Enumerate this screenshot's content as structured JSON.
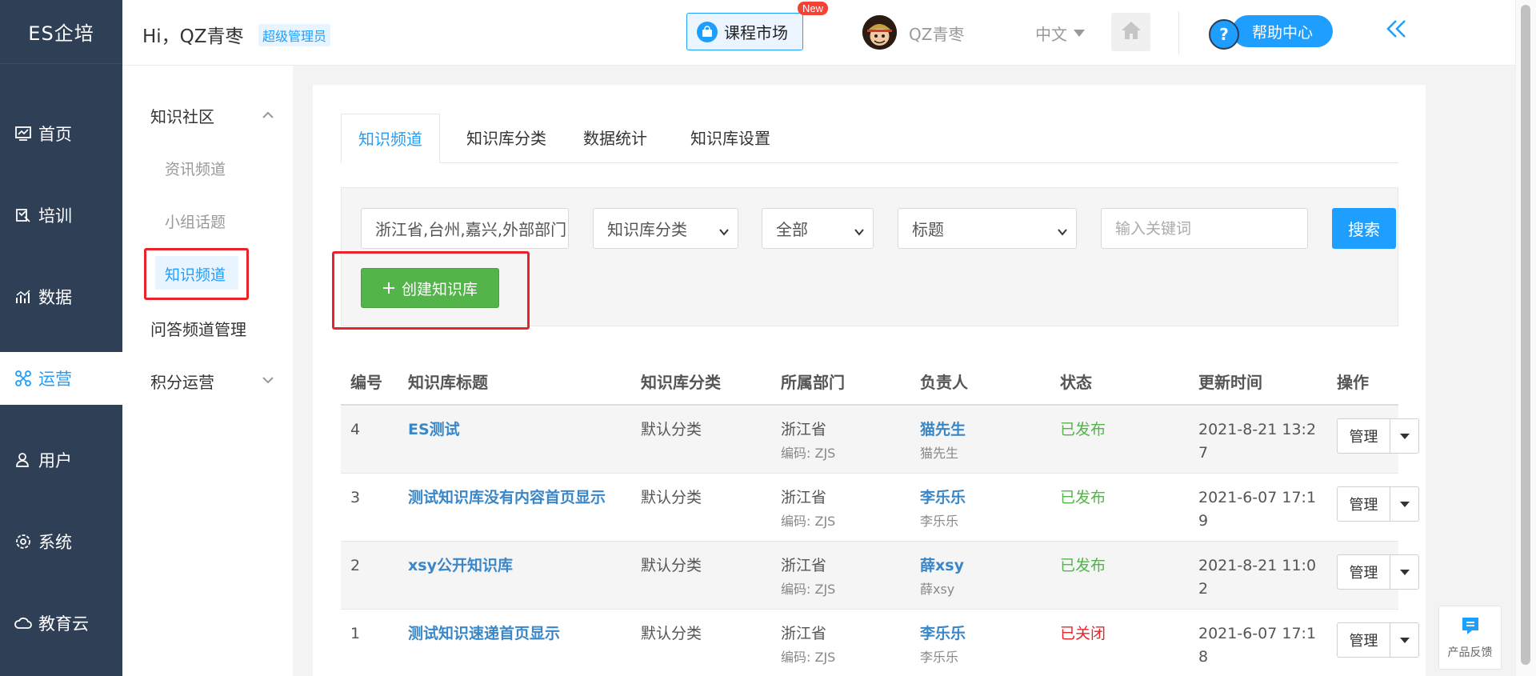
{
  "brand": "ES企培",
  "header": {
    "greeting": "Hi，QZ青枣",
    "role_badge": "超级管理员",
    "course_market": "课程市场",
    "new_tag": "New",
    "username": "QZ青枣",
    "language": "中文",
    "help_center": "帮助中心"
  },
  "nav": {
    "items": [
      {
        "label": "首页",
        "icon": "dashboard-icon"
      },
      {
        "label": "培训",
        "icon": "training-icon"
      },
      {
        "label": "数据",
        "icon": "chart-icon"
      },
      {
        "label": "运营",
        "icon": "operations-icon",
        "active": true
      },
      {
        "label": "用户",
        "icon": "user-icon"
      },
      {
        "label": "系统",
        "icon": "gear-icon"
      },
      {
        "label": "教育云",
        "icon": "cloud-icon"
      }
    ]
  },
  "submenu": {
    "group1": "知识社区",
    "items": [
      "资讯频道",
      "小组话题",
      "知识频道"
    ],
    "group2": "问答频道管理",
    "group3": "积分运营"
  },
  "tabs": [
    "知识频道",
    "知识库分类",
    "数据统计",
    "知识库设置"
  ],
  "filters": {
    "region": "浙江省,台州,嘉兴,外部部门",
    "category": "知识库分类",
    "status": "全部",
    "field": "标题",
    "keyword_placeholder": "输入关键词",
    "search": "搜索",
    "create": "创建知识库"
  },
  "table": {
    "headers": [
      "编号",
      "知识库标题",
      "知识库分类",
      "所属部门",
      "负责人",
      "状态",
      "更新时间",
      "操作"
    ],
    "rows": [
      {
        "id": "4",
        "title": "ES测试",
        "category": "默认分类",
        "dept": "浙江省",
        "code": "编码: ZJS",
        "owner": "猫先生",
        "owner_sub": "猫先生",
        "status": "已发布",
        "time1": "2021-8-21 13:2",
        "time2": "7",
        "manage": "管理"
      },
      {
        "id": "3",
        "title": "测试知识库没有内容首页显示",
        "category": "默认分类",
        "dept": "浙江省",
        "code": "编码: ZJS",
        "owner": "李乐乐",
        "owner_sub": "李乐乐",
        "status": "已发布",
        "time1": "2021-6-07 17:1",
        "time2": "9",
        "manage": "管理"
      },
      {
        "id": "2",
        "title": "xsy公开知识库",
        "category": "默认分类",
        "dept": "浙江省",
        "code": "编码: ZJS",
        "owner": "薛xsy",
        "owner_sub": "薛xsy",
        "status": "已发布",
        "time1": "2021-8-21 11:0",
        "time2": "2",
        "manage": "管理"
      },
      {
        "id": "1",
        "title": "测试知识速递首页显示",
        "category": "默认分类",
        "dept": "浙江省",
        "code": "编码: ZJS",
        "owner": "李乐乐",
        "owner_sub": "李乐乐",
        "status": "已关闭",
        "time1": "2021-6-07 17:1",
        "time2": "8",
        "manage": "管理"
      }
    ]
  },
  "feedback": "产品反馈",
  "colors": {
    "accent": "#1e9fff",
    "nav_bg": "#2f3f55",
    "create": "#52b449",
    "published": "#52b449",
    "closed": "#e8232b",
    "highlight": "#e8232b"
  }
}
